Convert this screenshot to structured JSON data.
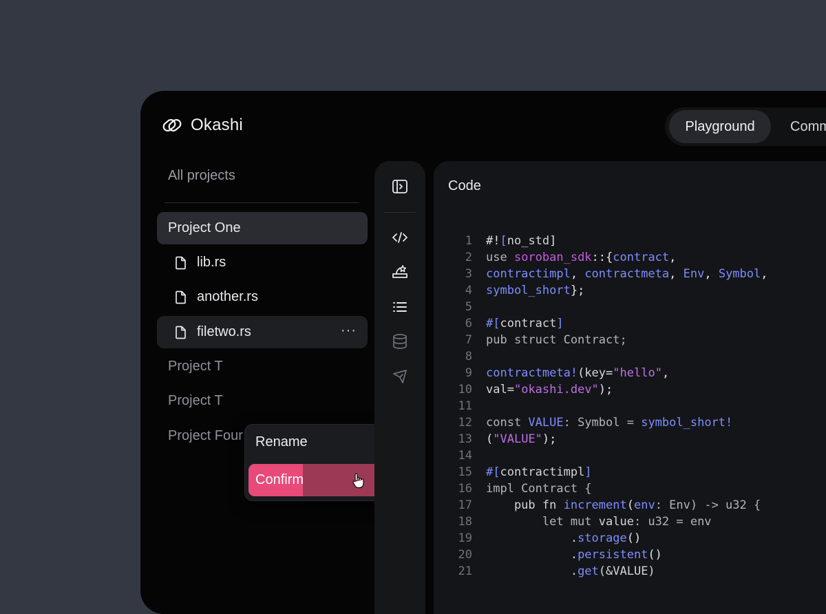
{
  "app": {
    "name": "Okashi"
  },
  "topnav": {
    "tabs": [
      "Playground",
      "Comm"
    ]
  },
  "sidebar": {
    "all_projects": "All projects",
    "projects": [
      {
        "label": "Project One"
      },
      {
        "label": "Project T"
      },
      {
        "label": "Project T"
      },
      {
        "label": "Project Four"
      }
    ],
    "files": [
      {
        "label": "lib.rs"
      },
      {
        "label": "another.rs"
      },
      {
        "label": "filetwo.rs"
      }
    ],
    "more_label": "···"
  },
  "context_menu": {
    "rename": "Rename",
    "confirm": "Confirm",
    "confirm_progress": 0.41,
    "colors": {
      "confirm_fill": "#e84a79",
      "confirm_base": "#9c3a55"
    }
  },
  "iconbar": {
    "icons": [
      "panel-toggle-icon",
      "code-icon",
      "deploy-icon",
      "list-icon",
      "database-icon",
      "send-icon"
    ]
  },
  "editor": {
    "title": "Code",
    "lines": [
      [
        [
          "1",
          "ln"
        ],
        [
          "#!",
          "pun"
        ],
        [
          "[",
          "bl"
        ],
        [
          "no_std",
          "txt"
        ],
        [
          "]",
          "pun"
        ]
      ],
      [
        [
          "2",
          "ln"
        ],
        [
          "use ",
          "kw"
        ],
        [
          "soroban_sdk",
          "pk"
        ],
        [
          "::{",
          "pun"
        ],
        [
          "contract",
          "bl"
        ],
        [
          ",",
          "pun"
        ]
      ],
      [
        [
          "3",
          "ln"
        ],
        [
          "contractimpl",
          "bl"
        ],
        [
          ", ",
          "pun"
        ],
        [
          "contractmeta",
          "bl"
        ],
        [
          ", ",
          "pun"
        ],
        [
          "Env",
          "bl"
        ],
        [
          ", ",
          "pun"
        ],
        [
          "Symbol",
          "bl"
        ],
        [
          ",",
          "pun"
        ]
      ],
      [
        [
          "4",
          "ln"
        ],
        [
          "symbol_short",
          "bl"
        ],
        [
          "};",
          "pun"
        ]
      ],
      [
        [
          "5",
          "ln"
        ]
      ],
      [
        [
          "6",
          "ln"
        ],
        [
          "#[",
          "bl"
        ],
        [
          "contract",
          "txt"
        ],
        [
          "]",
          "bl"
        ]
      ],
      [
        [
          "7",
          "ln"
        ],
        [
          "pub struct Contract;",
          "kw"
        ]
      ],
      [
        [
          "8",
          "ln"
        ]
      ],
      [
        [
          "9",
          "ln"
        ],
        [
          "contractmeta!",
          "bl"
        ],
        [
          "(",
          "pun"
        ],
        [
          "key",
          "txt"
        ],
        [
          "=",
          "pun"
        ],
        [
          "\"hello\"",
          "str"
        ],
        [
          ",",
          "pun"
        ]
      ],
      [
        [
          "10",
          "ln"
        ],
        [
          "val",
          "txt"
        ],
        [
          "=",
          "pun"
        ],
        [
          "\"okashi.dev\"",
          "str"
        ],
        [
          ");",
          "pun"
        ]
      ],
      [
        [
          "11",
          "ln"
        ]
      ],
      [
        [
          "12",
          "ln"
        ],
        [
          "const ",
          "kw"
        ],
        [
          "VALUE",
          "bl"
        ],
        [
          ": Symbol = ",
          "kw"
        ],
        [
          "symbol_short!",
          "bl"
        ]
      ],
      [
        [
          "13",
          "ln"
        ],
        [
          "(",
          "pun"
        ],
        [
          "\"VALUE\"",
          "str"
        ],
        [
          ");",
          "pun"
        ]
      ],
      [
        [
          "14",
          "ln"
        ]
      ],
      [
        [
          "15",
          "ln"
        ],
        [
          "#[",
          "bl"
        ],
        [
          "contractimpl",
          "txt"
        ],
        [
          "]",
          "bl"
        ]
      ],
      [
        [
          "16",
          "ln"
        ],
        [
          "impl Contract {",
          "kw"
        ]
      ],
      [
        [
          "17",
          "ln"
        ],
        [
          "    pub fn ",
          "txt"
        ],
        [
          "increment",
          "bl"
        ],
        [
          "(",
          "pun"
        ],
        [
          "env",
          "bl"
        ],
        [
          ": Env) -> u32 {",
          "kw"
        ]
      ],
      [
        [
          "18",
          "ln"
        ],
        [
          "        let mut ",
          "kw"
        ],
        [
          "value",
          "txt"
        ],
        [
          ": u32 = env",
          "kw"
        ]
      ],
      [
        [
          "19",
          "ln"
        ],
        [
          "            .",
          "txt"
        ],
        [
          "storage",
          "bl"
        ],
        [
          "()",
          "pun"
        ]
      ],
      [
        [
          "20",
          "ln"
        ],
        [
          "            .",
          "txt"
        ],
        [
          "persistent",
          "bl"
        ],
        [
          "()",
          "pun"
        ]
      ],
      [
        [
          "21",
          "ln"
        ],
        [
          "            .",
          "txt"
        ],
        [
          "get",
          "bl"
        ],
        [
          "(&VALUE)",
          "txt"
        ]
      ]
    ]
  }
}
